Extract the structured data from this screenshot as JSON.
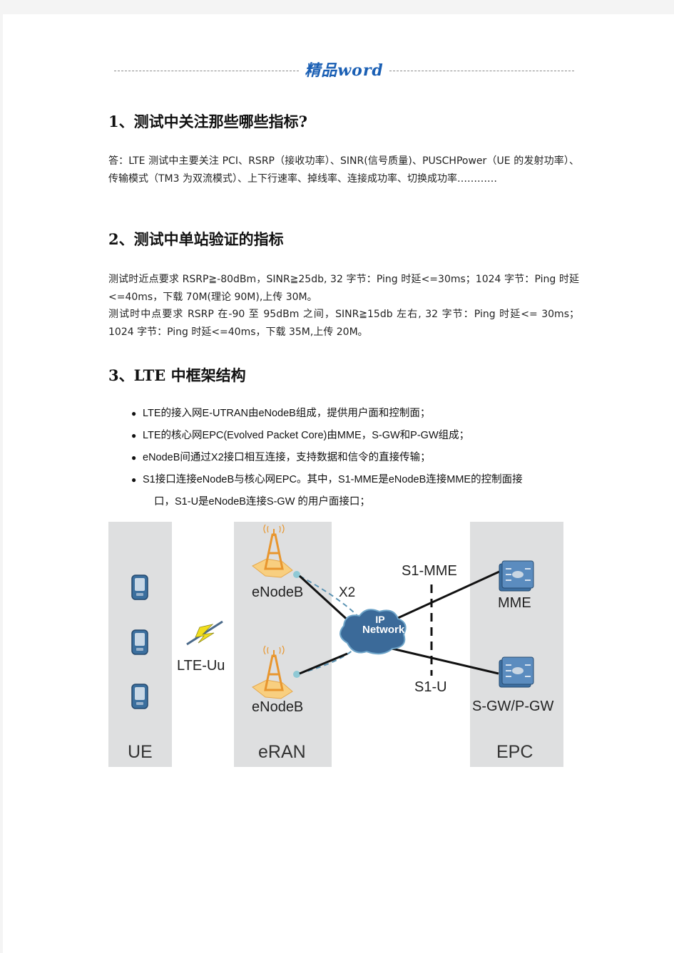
{
  "header": {
    "brand": "精品word"
  },
  "sections": [
    {
      "title": "1、测试中关注那些哪些指标?",
      "paragraphs": [
        "答：LTE 测试中主要关注 PCI、RSRP（接收功率）、SINR(信号质量)、PUSCHPower（UE 的发射功率）、传输模式（TM3 为双流模式）、上下行速率、掉线率、连接成功率、切换成功率…………"
      ]
    },
    {
      "title": "2、测试中单站验证的指标",
      "paragraphs": [
        "测试时近点要求 RSRP≧-80dBm，SINR≧25db, 32 字节：Ping 时延<=30ms；1024 字节：Ping 时延<=40ms，下载 70M(理论 90M),上传 30M。",
        "测试时中点要求 RSRP 在-90 至 95dBm 之间，SINR≧15db 左右, 32 字节：Ping 时延<= 30ms；1024 字节：Ping 时延<=40ms，下载 35M,上传 20M。"
      ]
    },
    {
      "title": "3、LTE 中框架结构",
      "bullets": [
        "LTE的接入网E-UTRAN由eNodeB组成，提供用户面和控制面；",
        "LTE的核心网EPC(Evolved  Packet  Core)由MME，S-GW和P-GW组成；",
        "eNodeB间通过X2接口相互连接，支持数据和信令的直接传输；",
        "S1接口连接eNodeB与核心网EPC。其中，S1-MME是eNodeB连接MME的控制面接",
        "口，S1-U是eNodeB连接S-GW  的用户面接口；"
      ]
    }
  ],
  "diagram": {
    "panels": {
      "ue": "UE",
      "eran": "eRAN",
      "epc": "EPC"
    },
    "air_interface": "LTE-Uu",
    "enodeb_top": "eNodeB",
    "enodeb_bottom": "eNodeB",
    "x2": "X2",
    "ip_network_line1": "IP",
    "ip_network_line2": "Network",
    "s1_mme": "S1-MME",
    "s1_u": "S1-U",
    "mme": "MME",
    "gw": "S-GW/P-GW",
    "colors": {
      "panel": "#dedfe0",
      "cloud": "#3b6a99",
      "tower": "#e8962e",
      "device": "#2f5f8e"
    }
  }
}
